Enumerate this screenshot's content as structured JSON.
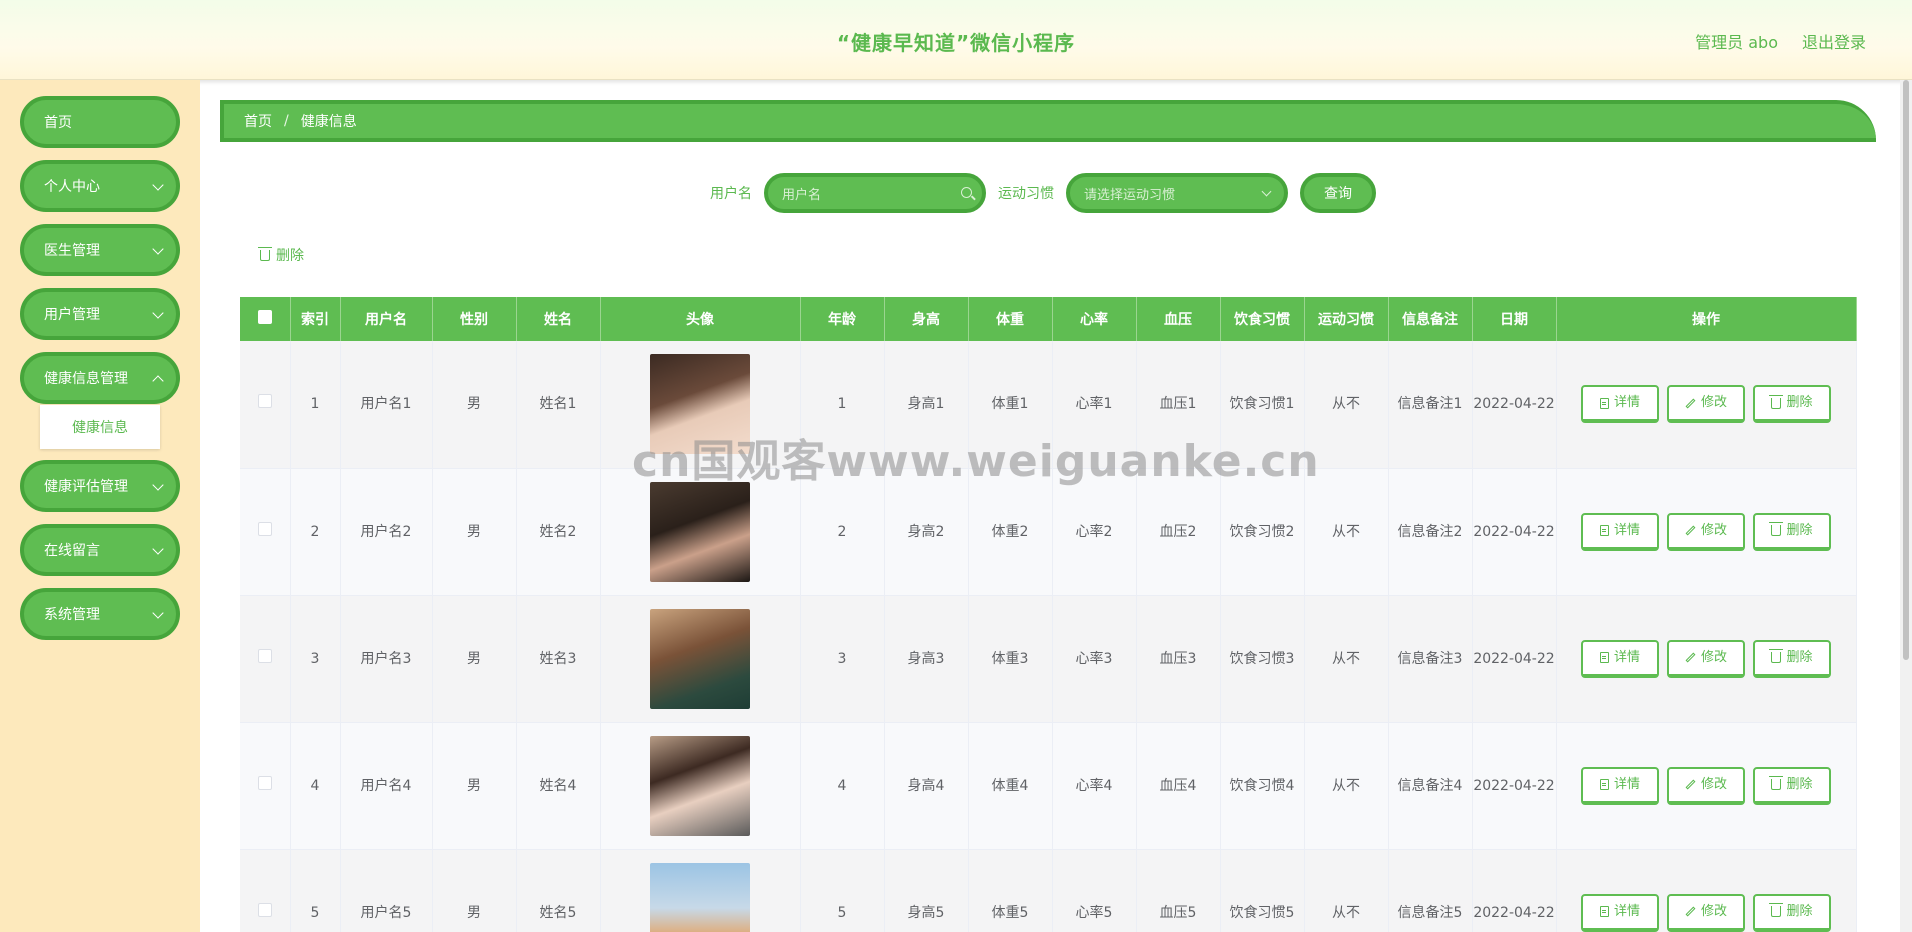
{
  "header": {
    "title": "“健康早知道”微信小程序",
    "admin": "管理员 abo",
    "logout": "退出登录"
  },
  "sidebar": {
    "items": [
      {
        "label": "首页"
      },
      {
        "label": "个人中心"
      },
      {
        "label": "医生管理"
      },
      {
        "label": "用户管理"
      },
      {
        "label": "健康信息管理"
      },
      {
        "label": "健康评估管理"
      },
      {
        "label": "在线留言"
      },
      {
        "label": "系统管理"
      }
    ],
    "submenu": "健康信息"
  },
  "breadcrumb": {
    "home": "首页",
    "sep": "/",
    "current": "健康信息"
  },
  "search": {
    "username_label": "用户名",
    "username_placeholder": "用户名",
    "habit_label": "运动习惯",
    "habit_placeholder": "请选择运动习惯",
    "query": "查询"
  },
  "toolbar": {
    "delete": "删除"
  },
  "table": {
    "headers": [
      "索引",
      "用户名",
      "性别",
      "姓名",
      "头像",
      "年龄",
      "身高",
      "体重",
      "心率",
      "血压",
      "饮食习惯",
      "运动习惯",
      "信息备注",
      "日期",
      "操作"
    ],
    "rows": [
      {
        "index": "1",
        "username": "用户名1",
        "gender": "男",
        "name": "姓名1",
        "age": "1",
        "height": "身高1",
        "weight": "体重1",
        "heart": "心率1",
        "bp": "血压1",
        "diet": "饮食习惯1",
        "sport": "从不",
        "note": "信息备注1",
        "date": "2022-04-22"
      },
      {
        "index": "2",
        "username": "用户名2",
        "gender": "男",
        "name": "姓名2",
        "age": "2",
        "height": "身高2",
        "weight": "体重2",
        "heart": "心率2",
        "bp": "血压2",
        "diet": "饮食习惯2",
        "sport": "从不",
        "note": "信息备注2",
        "date": "2022-04-22"
      },
      {
        "index": "3",
        "username": "用户名3",
        "gender": "男",
        "name": "姓名3",
        "age": "3",
        "height": "身高3",
        "weight": "体重3",
        "heart": "心率3",
        "bp": "血压3",
        "diet": "饮食习惯3",
        "sport": "从不",
        "note": "信息备注3",
        "date": "2022-04-22"
      },
      {
        "index": "4",
        "username": "用户名4",
        "gender": "男",
        "name": "姓名4",
        "age": "4",
        "height": "身高4",
        "weight": "体重4",
        "heart": "心率4",
        "bp": "血压4",
        "diet": "饮食习惯4",
        "sport": "从不",
        "note": "信息备注4",
        "date": "2022-04-22"
      },
      {
        "index": "5",
        "username": "用户名5",
        "gender": "男",
        "name": "姓名5",
        "age": "5",
        "height": "身高5",
        "weight": "体重5",
        "heart": "心率5",
        "bp": "血压5",
        "diet": "饮食习惯5",
        "sport": "从不",
        "note": "信息备注5",
        "date": "2022-04-22"
      }
    ],
    "actions": {
      "detail": "详情",
      "edit": "修改",
      "delete": "删除"
    }
  },
  "watermark": "cn国观客www.weiguanke.cn",
  "colors": {
    "primary": "#5fbd52",
    "primary_dark": "#46a53b",
    "sidebar_bg": "#fde9bc"
  }
}
